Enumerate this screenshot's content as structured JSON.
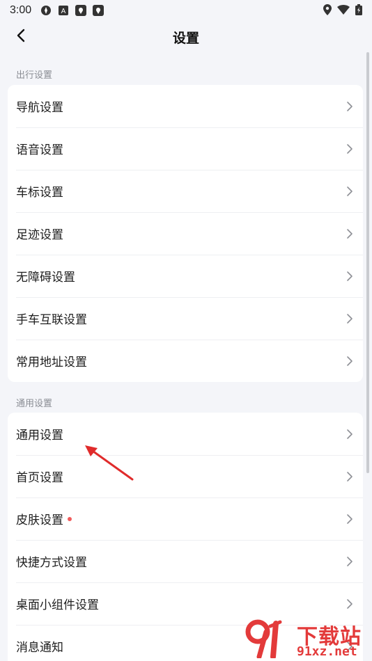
{
  "status_bar": {
    "time": "3:00",
    "icons": [
      "compass-icon",
      "a-badge-icon",
      "map-pin-app-icon",
      "map-pin-app-icon",
      "location-icon",
      "wifi-icon",
      "battery-icon"
    ]
  },
  "header": {
    "title": "设置",
    "back_icon": "chevron-left-icon"
  },
  "sections": [
    {
      "label": "出行设置",
      "items": [
        {
          "label": "导航设置"
        },
        {
          "label": "语音设置"
        },
        {
          "label": "车标设置"
        },
        {
          "label": "足迹设置"
        },
        {
          "label": "无障碍设置"
        },
        {
          "label": "手车互联设置"
        },
        {
          "label": "常用地址设置"
        }
      ]
    },
    {
      "label": "通用设置",
      "items": [
        {
          "label": "通用设置"
        },
        {
          "label": "首页设置"
        },
        {
          "label": "皮肤设置",
          "badge": "red-dot"
        },
        {
          "label": "快捷方式设置"
        },
        {
          "label": "桌面小组件设置"
        },
        {
          "label": "消息通知"
        }
      ]
    }
  ],
  "annotation": {
    "color": "#e02b2b"
  },
  "watermark": {
    "line1": "下载站",
    "line2": "91xz.net",
    "color": "#e33a3a"
  }
}
